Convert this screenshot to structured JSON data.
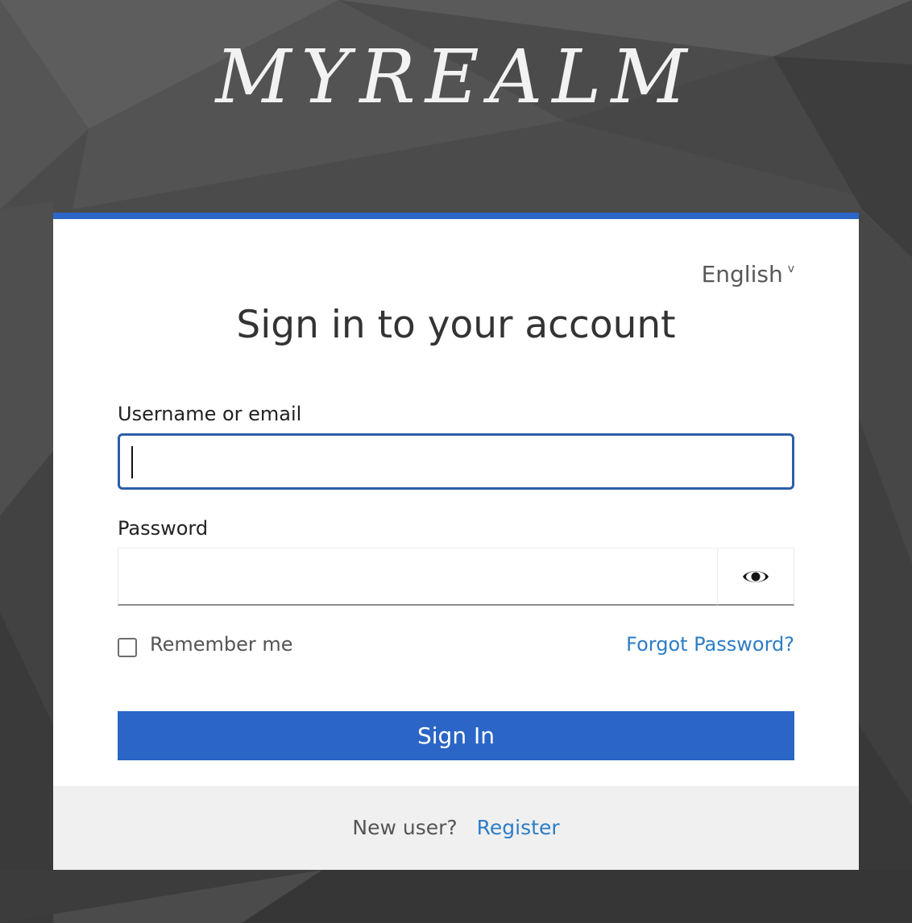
{
  "realm": {
    "title": "MYREALM"
  },
  "locale": {
    "selected": "English",
    "chevron": "v"
  },
  "form": {
    "heading": "Sign in to your account",
    "username_label": "Username or email",
    "username_value": "",
    "password_label": "Password",
    "password_value": "",
    "show_password_icon": "eye-icon",
    "remember_me_label": "Remember me",
    "remember_me_checked": false,
    "forgot_password_link": "Forgot Password?",
    "submit_label": "Sign In"
  },
  "footer": {
    "new_user_text": "New user?",
    "register_link": "Register"
  },
  "colors": {
    "accent": "#2b65c6",
    "link": "#2d7dc6",
    "background": "#4a4a4a",
    "footer_bg": "#f0f0f0"
  }
}
